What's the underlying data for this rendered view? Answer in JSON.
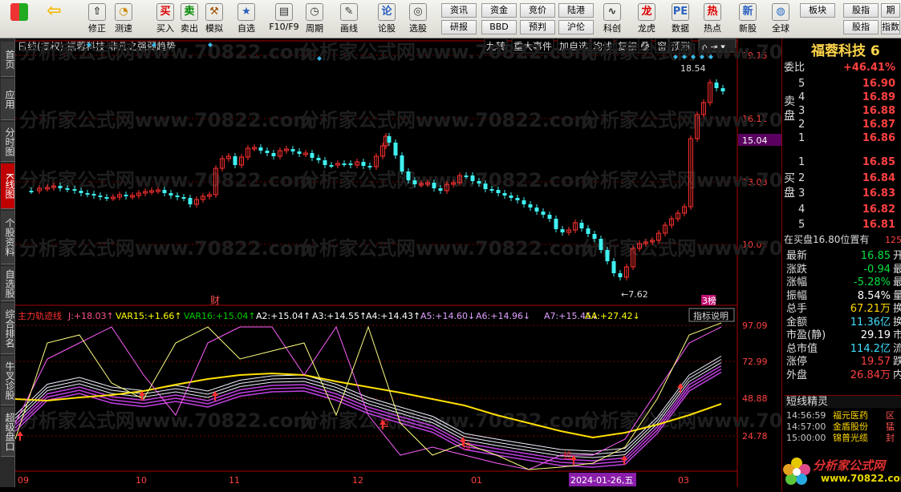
{
  "toolbar": {
    "items": [
      {
        "label": "修正",
        "icon": "up-arrow-icon"
      },
      {
        "label": "测速",
        "icon": "speed-icon"
      },
      {
        "label": "买入",
        "icon": "buy-icon"
      },
      {
        "label": "卖出",
        "icon": "sell-icon"
      },
      {
        "label": "模拟",
        "icon": "hammer-icon"
      },
      {
        "label": "自选",
        "icon": "star-icon"
      },
      {
        "label": "F10/F9",
        "icon": "f10-icon"
      },
      {
        "label": "周期",
        "icon": "period-icon"
      },
      {
        "label": "画线",
        "icon": "pencil-icon"
      },
      {
        "label": "论股",
        "icon": "talk-icon"
      },
      {
        "label": "选股",
        "icon": "select-icon"
      },
      {
        "label": "科创",
        "icon": "kechuang-icon"
      },
      {
        "label": "龙虎",
        "icon": "dragon-icon"
      },
      {
        "label": "数据",
        "icon": "pe-icon"
      },
      {
        "label": "热点",
        "icon": "hot-icon"
      },
      {
        "label": "新股",
        "icon": "new-stock-icon"
      },
      {
        "label": "全球",
        "icon": "globe-icon"
      }
    ],
    "small_buttons_row1": [
      "资讯",
      "资金",
      "竞价",
      "陆港",
      "板块",
      "股指"
    ],
    "small_buttons_row2": [
      "研报",
      "BBD",
      "预判",
      "沪伦",
      "股指"
    ],
    "extra_row1": "期",
    "extra_row2": "指数",
    "top_icons": {
      "logo": "app-grid-icon",
      "back": "back-arrow-icon"
    }
  },
  "left_tabs": [
    "首页",
    "应用",
    "分时图",
    "K线图",
    "个股资料",
    "自选股",
    "综合排名",
    "牛叉诊股",
    "超级盘口"
  ],
  "chart": {
    "header": "日线(复权)  福蓉科技  非凡之强弱趋势",
    "menu": [
      "九转",
      "重大事件",
      "加自选",
      "均线",
      "复权",
      "叠",
      "窗",
      "预测"
    ],
    "price_labels": [
      "19.15",
      "16.11",
      "13.08",
      "10.05"
    ],
    "current_price_tag": "15.04",
    "high_mark": "18.54",
    "low_mark": "7.62",
    "event_marks": [
      "财",
      "3榜"
    ],
    "indicator_title": "主力轨迹线",
    "indicator_values": [
      {
        "label": "J:",
        "value": "+18.03",
        "arrow": "↑",
        "color": "#ff5090"
      },
      {
        "label": "VAR15:",
        "value": "+1.66",
        "arrow": "↑",
        "color": "#ffff00"
      },
      {
        "label": "VAR16:",
        "value": "+15.04",
        "arrow": "↑",
        "color": "#00cc00"
      },
      {
        "label": "A2:",
        "value": "+15.04",
        "arrow": "↑",
        "color": "#ffffff"
      },
      {
        "label": "A3:",
        "value": "+14.55",
        "arrow": "↑",
        "color": "#ffffff"
      },
      {
        "label": "A4:",
        "value": "+14.43",
        "arrow": "↑",
        "color": "#ffffff"
      },
      {
        "label": "A5:",
        "value": "+14.60",
        "arrow": "↓",
        "color": "#e0a0ff"
      },
      {
        "label": "A6:",
        "value": "+14.96",
        "arrow": "↓",
        "color": "#e0a0ff"
      },
      {
        "label": "A7:",
        "value": "+15.45",
        "arrow": "↓",
        "color": "#e0a0ff"
      },
      {
        "label": "AA:",
        "value": "+27.42",
        "arrow": "↓",
        "color": "#ffff00"
      }
    ],
    "indicator_btn": "指标说明",
    "indicator_levels": [
      "97.09",
      "72.99",
      "48.88",
      "24.78"
    ],
    "signal_label": "拉",
    "x_labels": [
      "09",
      "10",
      "11",
      "12",
      "01",
      "03"
    ],
    "cursor_date": "2024-01-26,五",
    "watermark": "分析家公式网www.70822.com"
  },
  "right": {
    "title": "福蓉科技 6",
    "weibi_label": "委比",
    "weibi_value": "+46.41%",
    "sell_word": "卖盘",
    "buy_word": "买盘",
    "sell": [
      {
        "n": "5",
        "p": "16.90"
      },
      {
        "n": "4",
        "p": "16.89"
      },
      {
        "n": "3",
        "p": "16.88"
      },
      {
        "n": "2",
        "p": "16.87"
      },
      {
        "n": "1",
        "p": "16.86"
      }
    ],
    "buy": [
      {
        "n": "1",
        "p": "16.85"
      },
      {
        "n": "2",
        "p": "16.84"
      },
      {
        "n": "3",
        "p": "16.83"
      },
      {
        "n": "4",
        "p": "16.82"
      },
      {
        "n": "5",
        "p": "16.81"
      }
    ],
    "buy_note": "在买盘16.80位置有",
    "buy_note_num": "125",
    "stats": [
      {
        "l": "最新",
        "v": "16.85",
        "c": "green",
        "t": "开"
      },
      {
        "l": "涨跌",
        "v": "-0.94",
        "c": "green",
        "t": "最"
      },
      {
        "l": "涨幅",
        "v": "-5.28%",
        "c": "green",
        "t": "最"
      },
      {
        "l": "振幅",
        "v": "8.54%",
        "c": "white",
        "t": "量"
      },
      {
        "l": "总手",
        "v": "67.21万",
        "c": "yellow",
        "t": "换"
      },
      {
        "l": "金额",
        "v": "11.36亿",
        "c": "cyan",
        "t": "换"
      },
      {
        "l": "市盈(静)",
        "v": "29.19",
        "c": "white",
        "t": "市"
      },
      {
        "l": "总市值",
        "v": "114.2亿",
        "c": "cyan",
        "t": "流"
      },
      {
        "l": "涨停",
        "v": "19.57",
        "c": "red",
        "t": "跌"
      },
      {
        "l": "外盘",
        "v": "26.84万",
        "c": "red",
        "t": "内"
      }
    ],
    "elf_title": "短线精灵",
    "elf": [
      {
        "time": "14:56:59",
        "name": "福元医药",
        "tag": "区"
      },
      {
        "time": "14:57:00",
        "name": "金盾股份",
        "tag": "猛"
      },
      {
        "time": "15:00:00",
        "name": "锦普光缆",
        "tag": "封"
      }
    ],
    "logo_text": "分析家公式网",
    "logo_url": "www.70822.com"
  }
}
